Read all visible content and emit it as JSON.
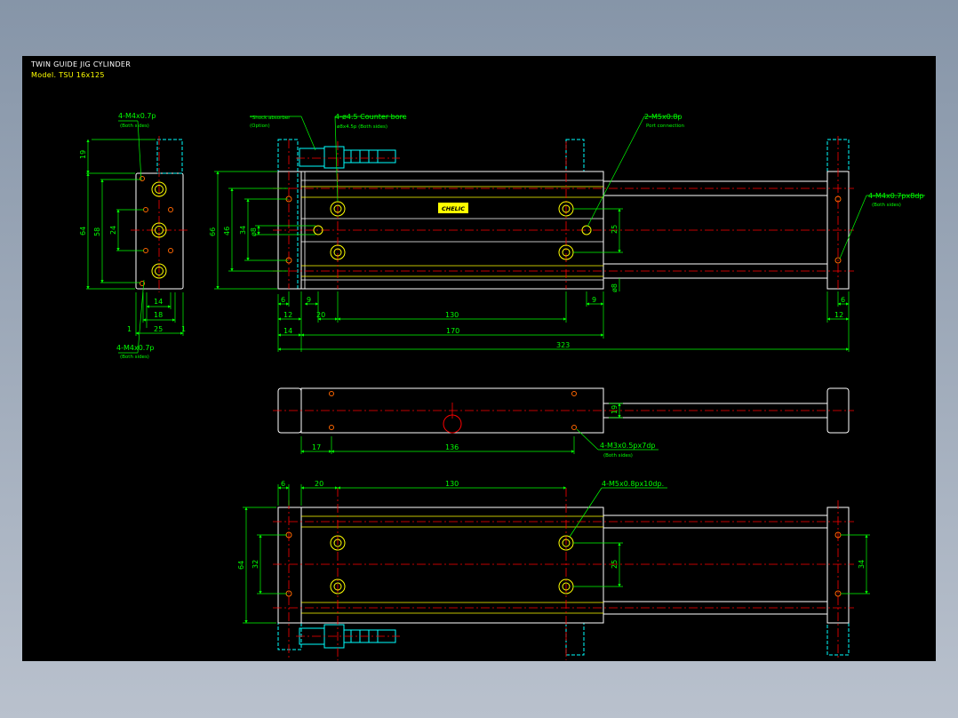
{
  "title": {
    "line1": "TWIN GUIDE JIG CYLINDER",
    "line2": "Model. TSU 16x125"
  },
  "colors": {
    "background": "#000000",
    "outline": "#ffffff",
    "dimension": "#00ff00",
    "centerline": "#ff0000",
    "hidden": "#00ffff",
    "title_model": "#ffff00",
    "label": "#ffff00"
  },
  "callouts": {
    "end_top_holes": "4-M4x0.7p",
    "end_top_holes_sub": "(Both sides)",
    "end_bottom_holes": "4-M4x0.7p",
    "end_bottom_holes_sub": "(Both sides)",
    "shock_absorber": "*Shock absorber",
    "shock_absorber_sub": "(Option)",
    "counter_bore": "4-ø4.5 Counter bore",
    "counter_bore_sub": "ø8x4.5p (Both sides)",
    "port": "2-M5x0.8p",
    "port_sub": "Port connection",
    "rod_plate_holes": "4-M4x0.7px8dp",
    "rod_plate_holes_sub": "(Both sides)",
    "middle_holes": "4-M3x0.5px7dp",
    "middle_holes_sub": "(Both sides)",
    "bottom_holes": "4-M5x0.8px10dp.",
    "nameplate": "CHELIC"
  },
  "dimensions": {
    "end_view": {
      "d19": "19",
      "d64": "64",
      "d58": "58",
      "d24": "24",
      "d14": "14",
      "d18": "18",
      "d25": "25",
      "d1a": "1",
      "d1b": "1"
    },
    "side_view": {
      "d66": "66",
      "d46": "46",
      "d34": "34",
      "phi8": "ø8",
      "d25": "25",
      "phi8b": "ø8",
      "d6": "6",
      "d12": "12",
      "d9": "9",
      "d20": "20",
      "d130": "130",
      "d9b": "9",
      "d6r": "6",
      "d12r": "12",
      "d14": "14",
      "d170": "170",
      "d323": "323"
    },
    "middle_view": {
      "d19": "19",
      "d17": "17",
      "d136": "136"
    },
    "bottom_view": {
      "d6": "6",
      "d20": "20",
      "d130": "130",
      "d64": "64",
      "d32": "32",
      "d25": "25",
      "d34": "34"
    }
  }
}
